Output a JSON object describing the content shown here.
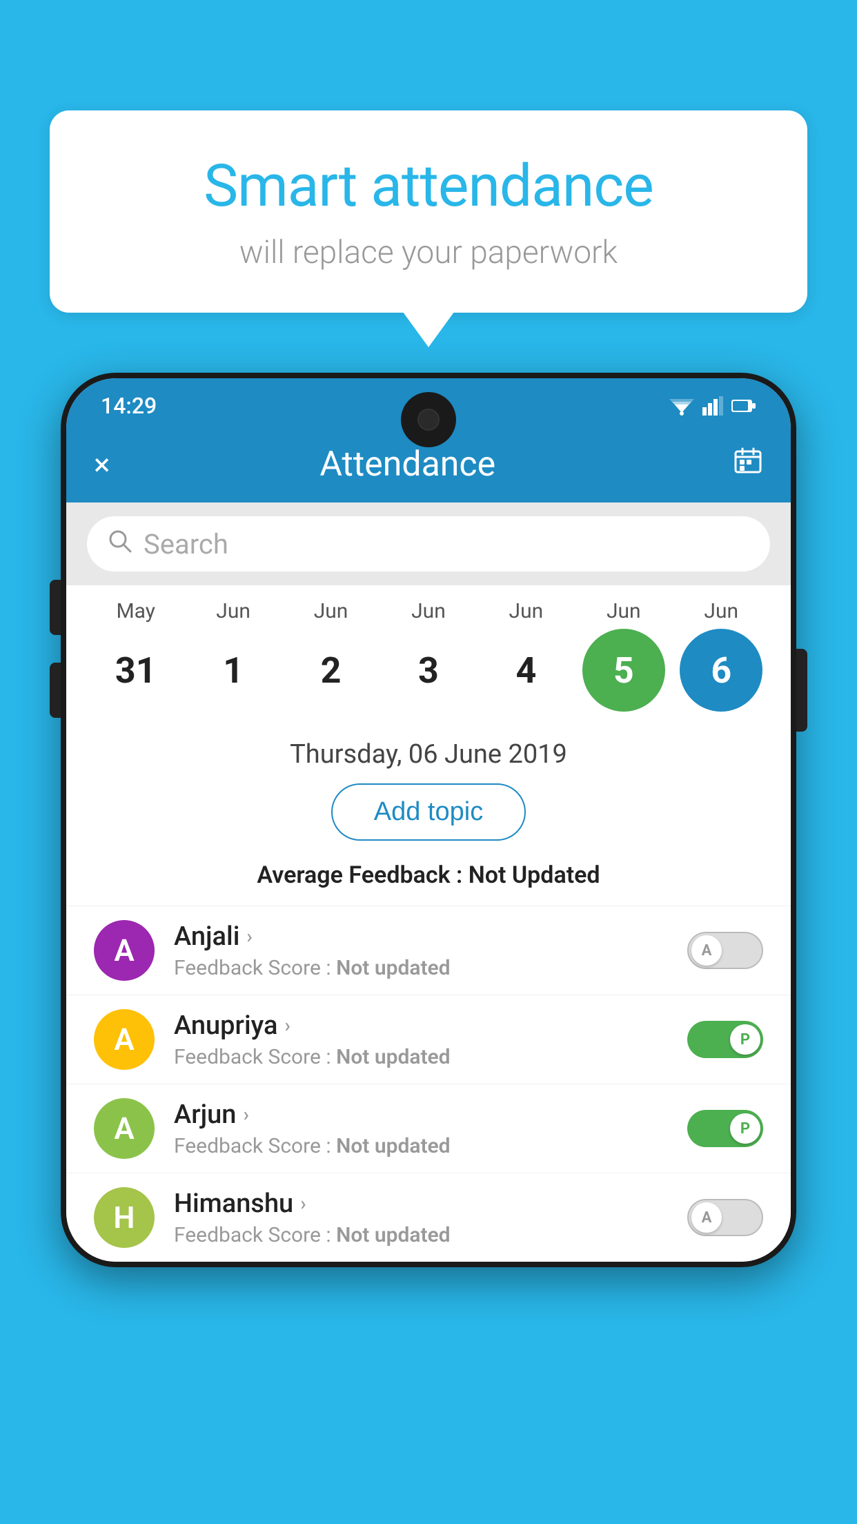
{
  "background_color": "#29b6e8",
  "speech_bubble": {
    "title": "Smart attendance",
    "subtitle": "will replace your paperwork"
  },
  "status_bar": {
    "time": "14:29"
  },
  "app_bar": {
    "title": "Attendance",
    "close_label": "×",
    "calendar_icon": "calendar"
  },
  "search": {
    "placeholder": "Search"
  },
  "calendar": {
    "months": [
      "May",
      "Jun",
      "Jun",
      "Jun",
      "Jun",
      "Jun",
      "Jun"
    ],
    "dates": [
      "31",
      "1",
      "2",
      "3",
      "4",
      "5",
      "6"
    ],
    "selected_green": "5",
    "selected_blue": "6"
  },
  "selected_date_label": "Thursday, 06 June 2019",
  "add_topic_label": "Add topic",
  "average_feedback_label": "Average Feedback :",
  "average_feedback_value": "Not Updated",
  "students": [
    {
      "name": "Anjali",
      "avatar_letter": "A",
      "avatar_color": "#9c27b0",
      "feedback_label": "Feedback Score : Not updated",
      "toggle_state": "off",
      "toggle_letter": "A"
    },
    {
      "name": "Anupriya",
      "avatar_letter": "A",
      "avatar_color": "#ffc107",
      "feedback_label": "Feedback Score : Not updated",
      "toggle_state": "on",
      "toggle_letter": "P"
    },
    {
      "name": "Arjun",
      "avatar_letter": "A",
      "avatar_color": "#8bc34a",
      "feedback_label": "Feedback Score : Not updated",
      "toggle_state": "on",
      "toggle_letter": "P"
    },
    {
      "name": "Himanshu",
      "avatar_letter": "H",
      "avatar_color": "#a5c44a",
      "feedback_label": "Feedback Score : Not updated",
      "toggle_state": "off",
      "toggle_letter": "A"
    }
  ]
}
